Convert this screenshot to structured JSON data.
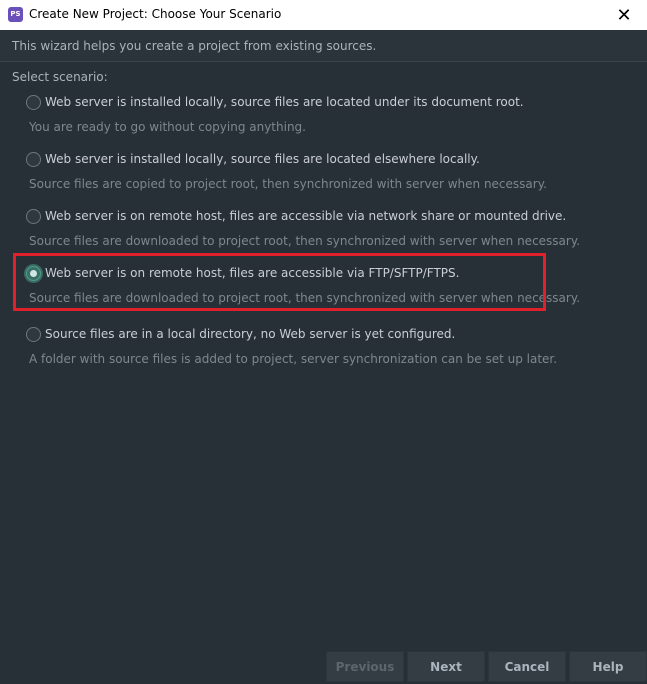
{
  "window": {
    "app_icon": "PS",
    "title": "Create New Project: Choose Your Scenario",
    "close_glyph": "✕"
  },
  "intro": "This wizard helps you create a project from existing sources.",
  "select_label": "Select scenario:",
  "options": [
    {
      "label": "Web server is installed locally, source files are located under its document root.",
      "description": "You are ready to go without copying anything.",
      "selected": false
    },
    {
      "label": "Web server is installed locally, source files are located elsewhere locally.",
      "description": "Source files are copied to project root, then synchronized with server when necessary.",
      "selected": false
    },
    {
      "label": "Web server is on remote host, files are accessible via network share or mounted drive.",
      "description": "Source files are downloaded to project root, then synchronized with server when necessary.",
      "selected": false
    },
    {
      "label": "Web server is on remote host, files are accessible via FTP/SFTP/FTPS.",
      "description": "Source files are downloaded to project root, then synchronized with server when necessary.",
      "selected": true
    },
    {
      "label": "Source files are in a local directory, no Web server is yet configured.",
      "description": "A folder with source files is added to project, server synchronization can be set up later.",
      "selected": false
    }
  ],
  "buttons": {
    "previous": "Previous",
    "next": "Next",
    "cancel": "Cancel",
    "help": "Help"
  },
  "colors": {
    "highlight": "#e0202a",
    "background": "#283037"
  }
}
